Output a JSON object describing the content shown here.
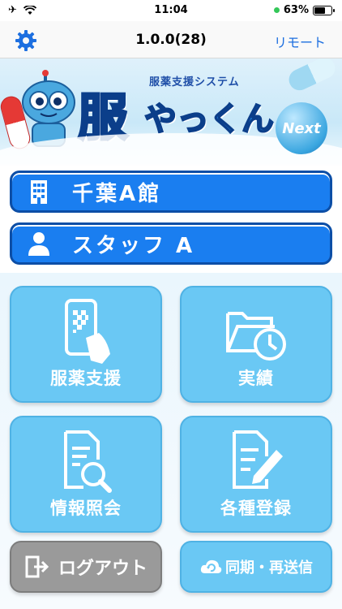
{
  "status_bar": {
    "time": "11:04",
    "battery_percent": "63%",
    "battery_level": 0.63
  },
  "nav": {
    "title": "1.0.0(28)",
    "remote_label": "リモート"
  },
  "banner": {
    "subtitle": "服薬支援システム",
    "logo_main": "服",
    "logo_rest": "やっくん",
    "logo_badge": "Next"
  },
  "facility": {
    "label": "千葉A館"
  },
  "staff": {
    "label": "スタッフ A"
  },
  "tiles": [
    {
      "label": "服薬支援",
      "icon": "phone-qr-icon"
    },
    {
      "label": "実績",
      "icon": "folder-clock-icon"
    },
    {
      "label": "情報照会",
      "icon": "document-search-icon"
    },
    {
      "label": "各種登録",
      "icon": "document-edit-icon"
    }
  ],
  "buttons": {
    "logout_label": "ログアウト",
    "sync_label": "同期・再送信"
  },
  "colors": {
    "accent": "#1a7ef0",
    "tile": "#6ac8f4",
    "logout": "#9a9a9a",
    "link": "#1d6fe0"
  }
}
